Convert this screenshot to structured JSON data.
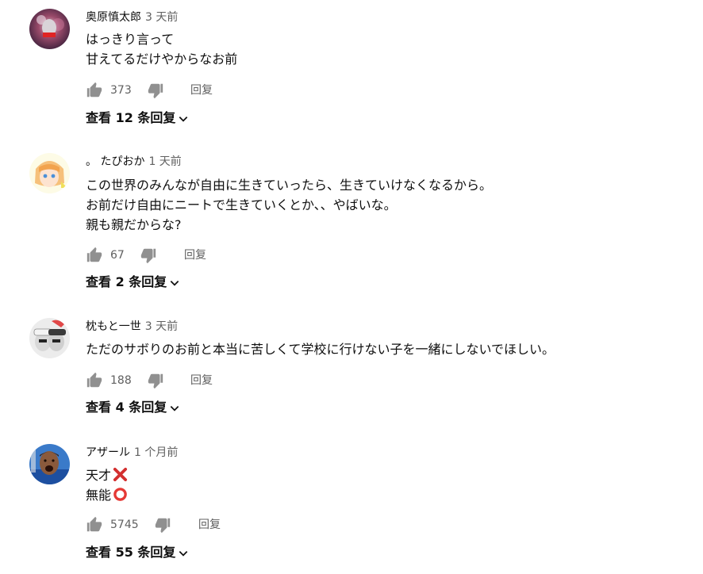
{
  "comments": [
    {
      "author": "奥原慎太郎",
      "time": "3 天前",
      "lines": [
        "はっきり言って",
        "甘えてるだけやからなお前"
      ],
      "likes": "373",
      "reply_label": "回复",
      "replies_label": "查看 12 条回复",
      "avatar_icon": "galaxy-avatar-icon"
    },
    {
      "author": "。 たぴおか",
      "time": "1 天前",
      "lines": [
        "この世界のみんなが自由に生きていったら、生きていけなくなるから。",
        "お前だけ自由にニートで生きていくとか、、やばいな。",
        "親も親だからな?"
      ],
      "likes": "67",
      "reply_label": "回复",
      "replies_label": "查看 2 条回复",
      "avatar_icon": "anime-girl-avatar-icon"
    },
    {
      "author": "枕もと一世",
      "time": "3 天前",
      "lines": [
        "ただのサボりのお前と本当に苦しくて学校に行けない子を一緒にしないでほしい。"
      ],
      "likes": "188",
      "reply_label": "回复",
      "replies_label": "查看 4 条回复",
      "avatar_icon": "two-people-avatar-icon"
    },
    {
      "author": "アザール",
      "time": "1 个月前",
      "lines": [
        "天才",
        "無能"
      ],
      "line_marks": [
        "cross-mark-icon",
        "circle-mark-icon"
      ],
      "likes": "5745",
      "reply_label": "回复",
      "replies_label": "查看 55 条回复",
      "avatar_icon": "footballer-avatar-icon"
    }
  ],
  "colors": {
    "text": "#0f0f0f",
    "secondary": "#606060",
    "cross": "#d32f2f",
    "circle": "#e53935"
  }
}
